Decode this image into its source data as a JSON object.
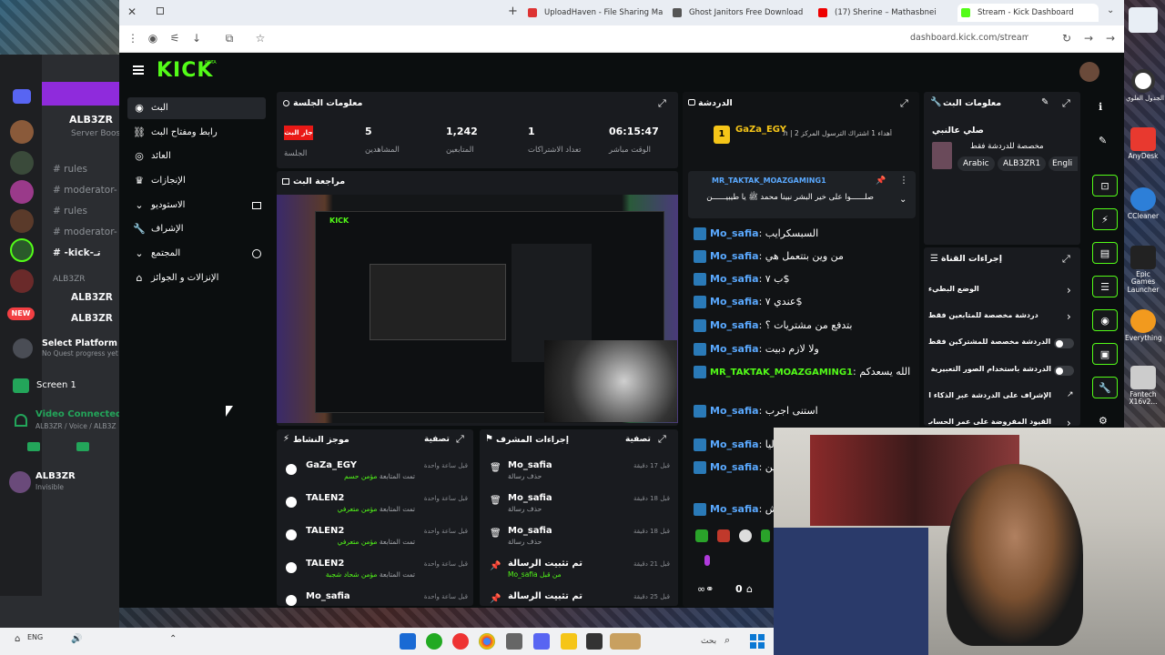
{
  "browser": {
    "tabs": [
      {
        "label": "UploadHaven - File Sharing Ma"
      },
      {
        "label": "Ghost Janitors Free Download"
      },
      {
        "label": "(17) Sherine – Mathasbnei"
      },
      {
        "label": "Stream - Kick Dashboard"
      }
    ],
    "url": "dashboard.kick.com/stream"
  },
  "discord": {
    "server_name": "ALB3ZR",
    "server_sub": "Server Boost",
    "channels": [
      "rules",
      "moderator-",
      "rules",
      "moderator-",
      "-kick-تـ"
    ],
    "section": "ALB3ZR",
    "voice_items": [
      "ALB3ZR",
      "ALB3ZR"
    ],
    "new_badge": "NEW",
    "select_platform": "Select Platform",
    "select_platform_sub": "No Quest progress yet",
    "screen_label": "Screen 1",
    "video_connected": "Video Connected",
    "video_sub": "ALB3ZR / Voice / ALB3Z",
    "user_name": "ALB3ZR",
    "user_status": "Invisible"
  },
  "kick": {
    "logo": "KICK",
    "logo_sup": "BETA",
    "nav": [
      {
        "label": "البث",
        "icon": "broadcast-icon"
      },
      {
        "label": "رابط ومفتاح البث",
        "icon": "link-icon"
      },
      {
        "label": "العائد",
        "icon": "coins-icon"
      },
      {
        "label": "الإنجازات",
        "icon": "trophy-icon"
      },
      {
        "label": "الاستوديو",
        "icon": "chevron-down-icon"
      },
      {
        "label": "الإشراف",
        "icon": "wrench-icon"
      },
      {
        "label": "المجتمع",
        "icon": "chevron-down-icon"
      },
      {
        "label": "الإنزالات و الجوائز",
        "icon": "gift-icon"
      }
    ],
    "session": {
      "title": "معلومات الجلسة",
      "live_badge": "جار البث",
      "session_label": "الجلسة",
      "stats": [
        {
          "value": "5",
          "label": "المشاهدين"
        },
        {
          "value": "1,242",
          "label": "المتابعين"
        },
        {
          "value": "1",
          "label": "تعداد الاشتراكات"
        },
        {
          "value": "06:15:47",
          "label": "الوقت مباشر"
        }
      ]
    },
    "preview_title": "مراجعة البث",
    "activity": {
      "title": "موجز النشاط",
      "filter": "تصفية",
      "rows": [
        {
          "name": "GaZa_EGY",
          "sub_a": "تمت المتابعة",
          "sub_b": "مؤمن حسم",
          "time": "قبل ساعة واحدة"
        },
        {
          "name": "TALEN2",
          "sub_a": "تمت المتابعة",
          "sub_b": "مؤمن متعرفي",
          "time": "قبل ساعة واحدة"
        },
        {
          "name": "TALEN2",
          "sub_a": "تمت المتابعة",
          "sub_b": "مؤمن متعرفي",
          "time": "قبل ساعة واحدة"
        },
        {
          "name": "TALEN2",
          "sub_a": "تمت المتابعة",
          "sub_b": "مؤمن شحاد شجبة",
          "time": "قبل ساعة واحدة"
        },
        {
          "name": "Mo_safia",
          "sub_a": "",
          "sub_b": "",
          "time": "قبل ساعة واحدة"
        }
      ]
    },
    "mod": {
      "title": "إجراءات المشرف",
      "filter": "تصفية",
      "rows": [
        {
          "name": "Mo_safia",
          "sub": "حذف رسالة",
          "time": "قبل 17 دقيقة"
        },
        {
          "name": "Mo_safia",
          "sub": "حذف رسالة",
          "time": "قبل 18 دقيقة"
        },
        {
          "name": "Mo_safia",
          "sub": "حذف رسالة",
          "time": "قبل 18 دقيقة"
        },
        {
          "name": "تم تثبيت الرسالة",
          "sub": "من قبل Mo_safia",
          "time": "قبل 21 دقيقة"
        },
        {
          "name": "تم تثبيت الرسالة",
          "sub": "",
          "time": "قبل 25 دقيقة"
        }
      ]
    },
    "chat": {
      "title": "الدردشة",
      "gift_user": "GaZa_EGY",
      "gift_text": "أهداء 1 اشتراك الترسول المركز 2 | th",
      "pinned_user": "MR_TAKTAK_MOAZGAMING1",
      "pinned_text": "صلــــــوا على خير البشر نبينا محمد ﷺ يا طيبيــــــن",
      "messages": [
        {
          "user": "Mo_safia",
          "msg": "السبسكرايب"
        },
        {
          "user": "Mo_safia",
          "msg": "من وين بتتعمل هي"
        },
        {
          "user": "Mo_safia",
          "msg": "ب ٧$"
        },
        {
          "user": "Mo_safia",
          "msg": "عندي ٧$"
        },
        {
          "user": "Mo_safia",
          "msg": "بتدفع من مشتريات ؟"
        },
        {
          "user": "Mo_safia",
          "msg": "ولا لازم دبيت"
        },
        {
          "user": "MR_TAKTAK_MOAZGAMING1",
          "msg": "شير انكم للبث الله يسعدكم"
        },
        {
          "user": "Mo_safia",
          "msg": "استنى اجرب"
        },
        {
          "user": "Mo_safia",
          "msg": "ليا"
        },
        {
          "user": "Mo_safia",
          "msg": "ين"
        },
        {
          "user": "Mo_safia",
          "msg": "ش"
        }
      ],
      "viewer_count": "0"
    },
    "stream_info": {
      "title": "معلومات البث",
      "stream_title": "صلي عالنبي",
      "stream_sub": "مخصصة للدردشة فقط",
      "tags": [
        "Arabic",
        "ALB3ZR1",
        "Engli"
      ]
    },
    "channel_actions": {
      "title": "إجراءات القناة",
      "rows": [
        {
          "label": "الوضع البطيء",
          "control": "chevron"
        },
        {
          "label": "دردشة مخصصة للمتابعين فقط",
          "control": "chevron"
        },
        {
          "label": "الدردشة مخصصة للمشتركين فقط",
          "control": "toggle"
        },
        {
          "label": "الدردشة باستخدام الصور التعبيرية فقط",
          "control": "toggle"
        },
        {
          "label": "الإشراف على الدردشة عبر الذكاء الاصطناعي",
          "control": "link"
        },
        {
          "label": "القيود المفروضة على عمر الحساب",
          "control": "chevron"
        }
      ]
    }
  },
  "desktop": {
    "icons": [
      "AnyDesk",
      "CCleaner",
      "Epic Games Launcher",
      "Everything",
      "Fantech X16v2..."
    ],
    "top_icon_label": "الجدول العلوي"
  },
  "taskbar": {
    "tray_text": "بحث",
    "tray_lang": "ENG"
  },
  "colors": {
    "kick_green": "#53fc18",
    "panel_bg": "#191b1f",
    "live_red": "#e91916",
    "chat_user": "#5aa9ff"
  }
}
